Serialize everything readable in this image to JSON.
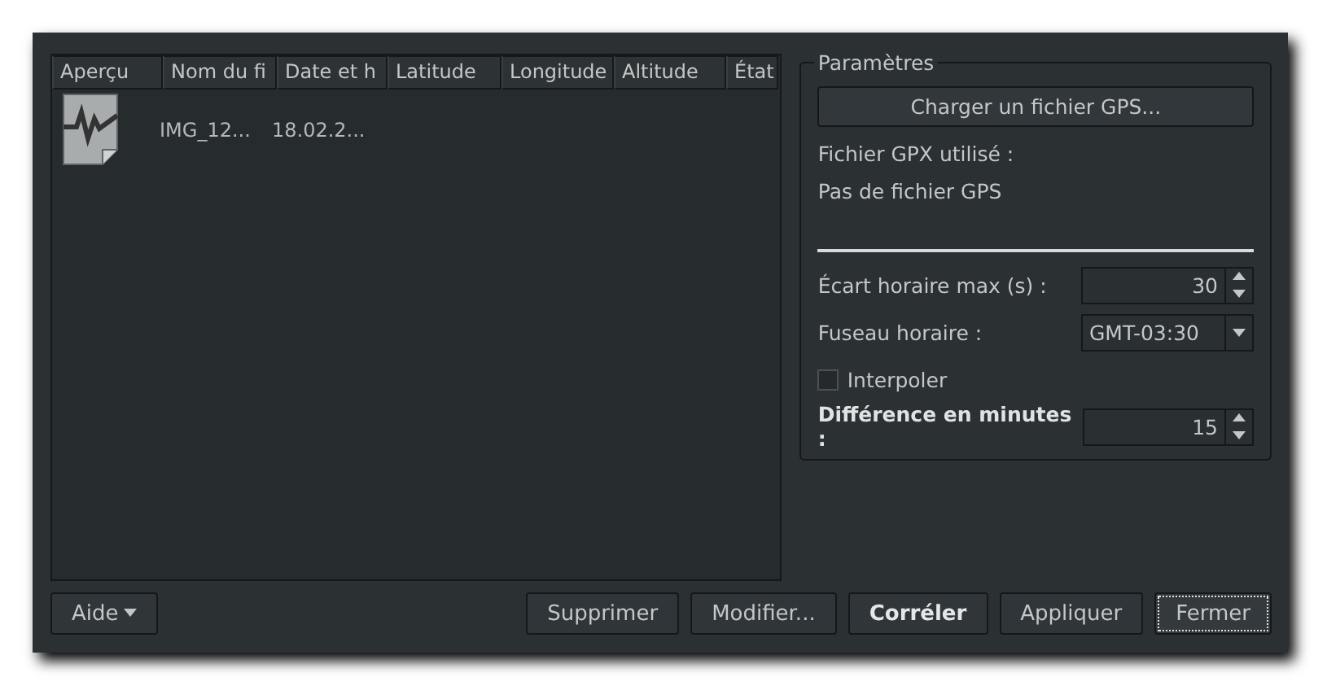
{
  "table": {
    "columns": [
      "Aperçu",
      "Nom du fi",
      "Date et h",
      "Latitude",
      "Longitude",
      "Altitude",
      "État"
    ],
    "rows": [
      {
        "kind": "picture",
        "name": "IMG_12...",
        "date": "18.02.2..."
      }
    ]
  },
  "settings": {
    "title": "Paramètres",
    "load_button": "Charger un fichier GPS...",
    "gpx_label": "Fichier GPX utilisé :",
    "gpx_value": "Pas de fichier GPS",
    "fields": [
      {
        "kind": "spin",
        "label": "Écart horaire max (s) :",
        "value": "30"
      },
      {
        "kind": "combo",
        "label": "Fuseau horaire :",
        "value": "GMT-03:30"
      },
      {
        "kind": "check",
        "label": "Interpoler",
        "checked": false
      },
      {
        "kind": "spin",
        "label": "Différence en minutes :",
        "value": "15"
      }
    ]
  },
  "buttons": [
    {
      "label": "Aide",
      "kind": "menu",
      "default": false,
      "focused": false
    },
    {
      "label": "Supprimer",
      "kind": "push",
      "default": false,
      "focused": false
    },
    {
      "label": "Modifier...",
      "kind": "push",
      "default": false,
      "focused": false
    },
    {
      "label": "Corréler",
      "kind": "push",
      "default": true,
      "focused": false
    },
    {
      "label": "Appliquer",
      "kind": "push",
      "default": false,
      "focused": false
    },
    {
      "label": "Fermer",
      "kind": "push",
      "default": false,
      "focused": true
    }
  ]
}
